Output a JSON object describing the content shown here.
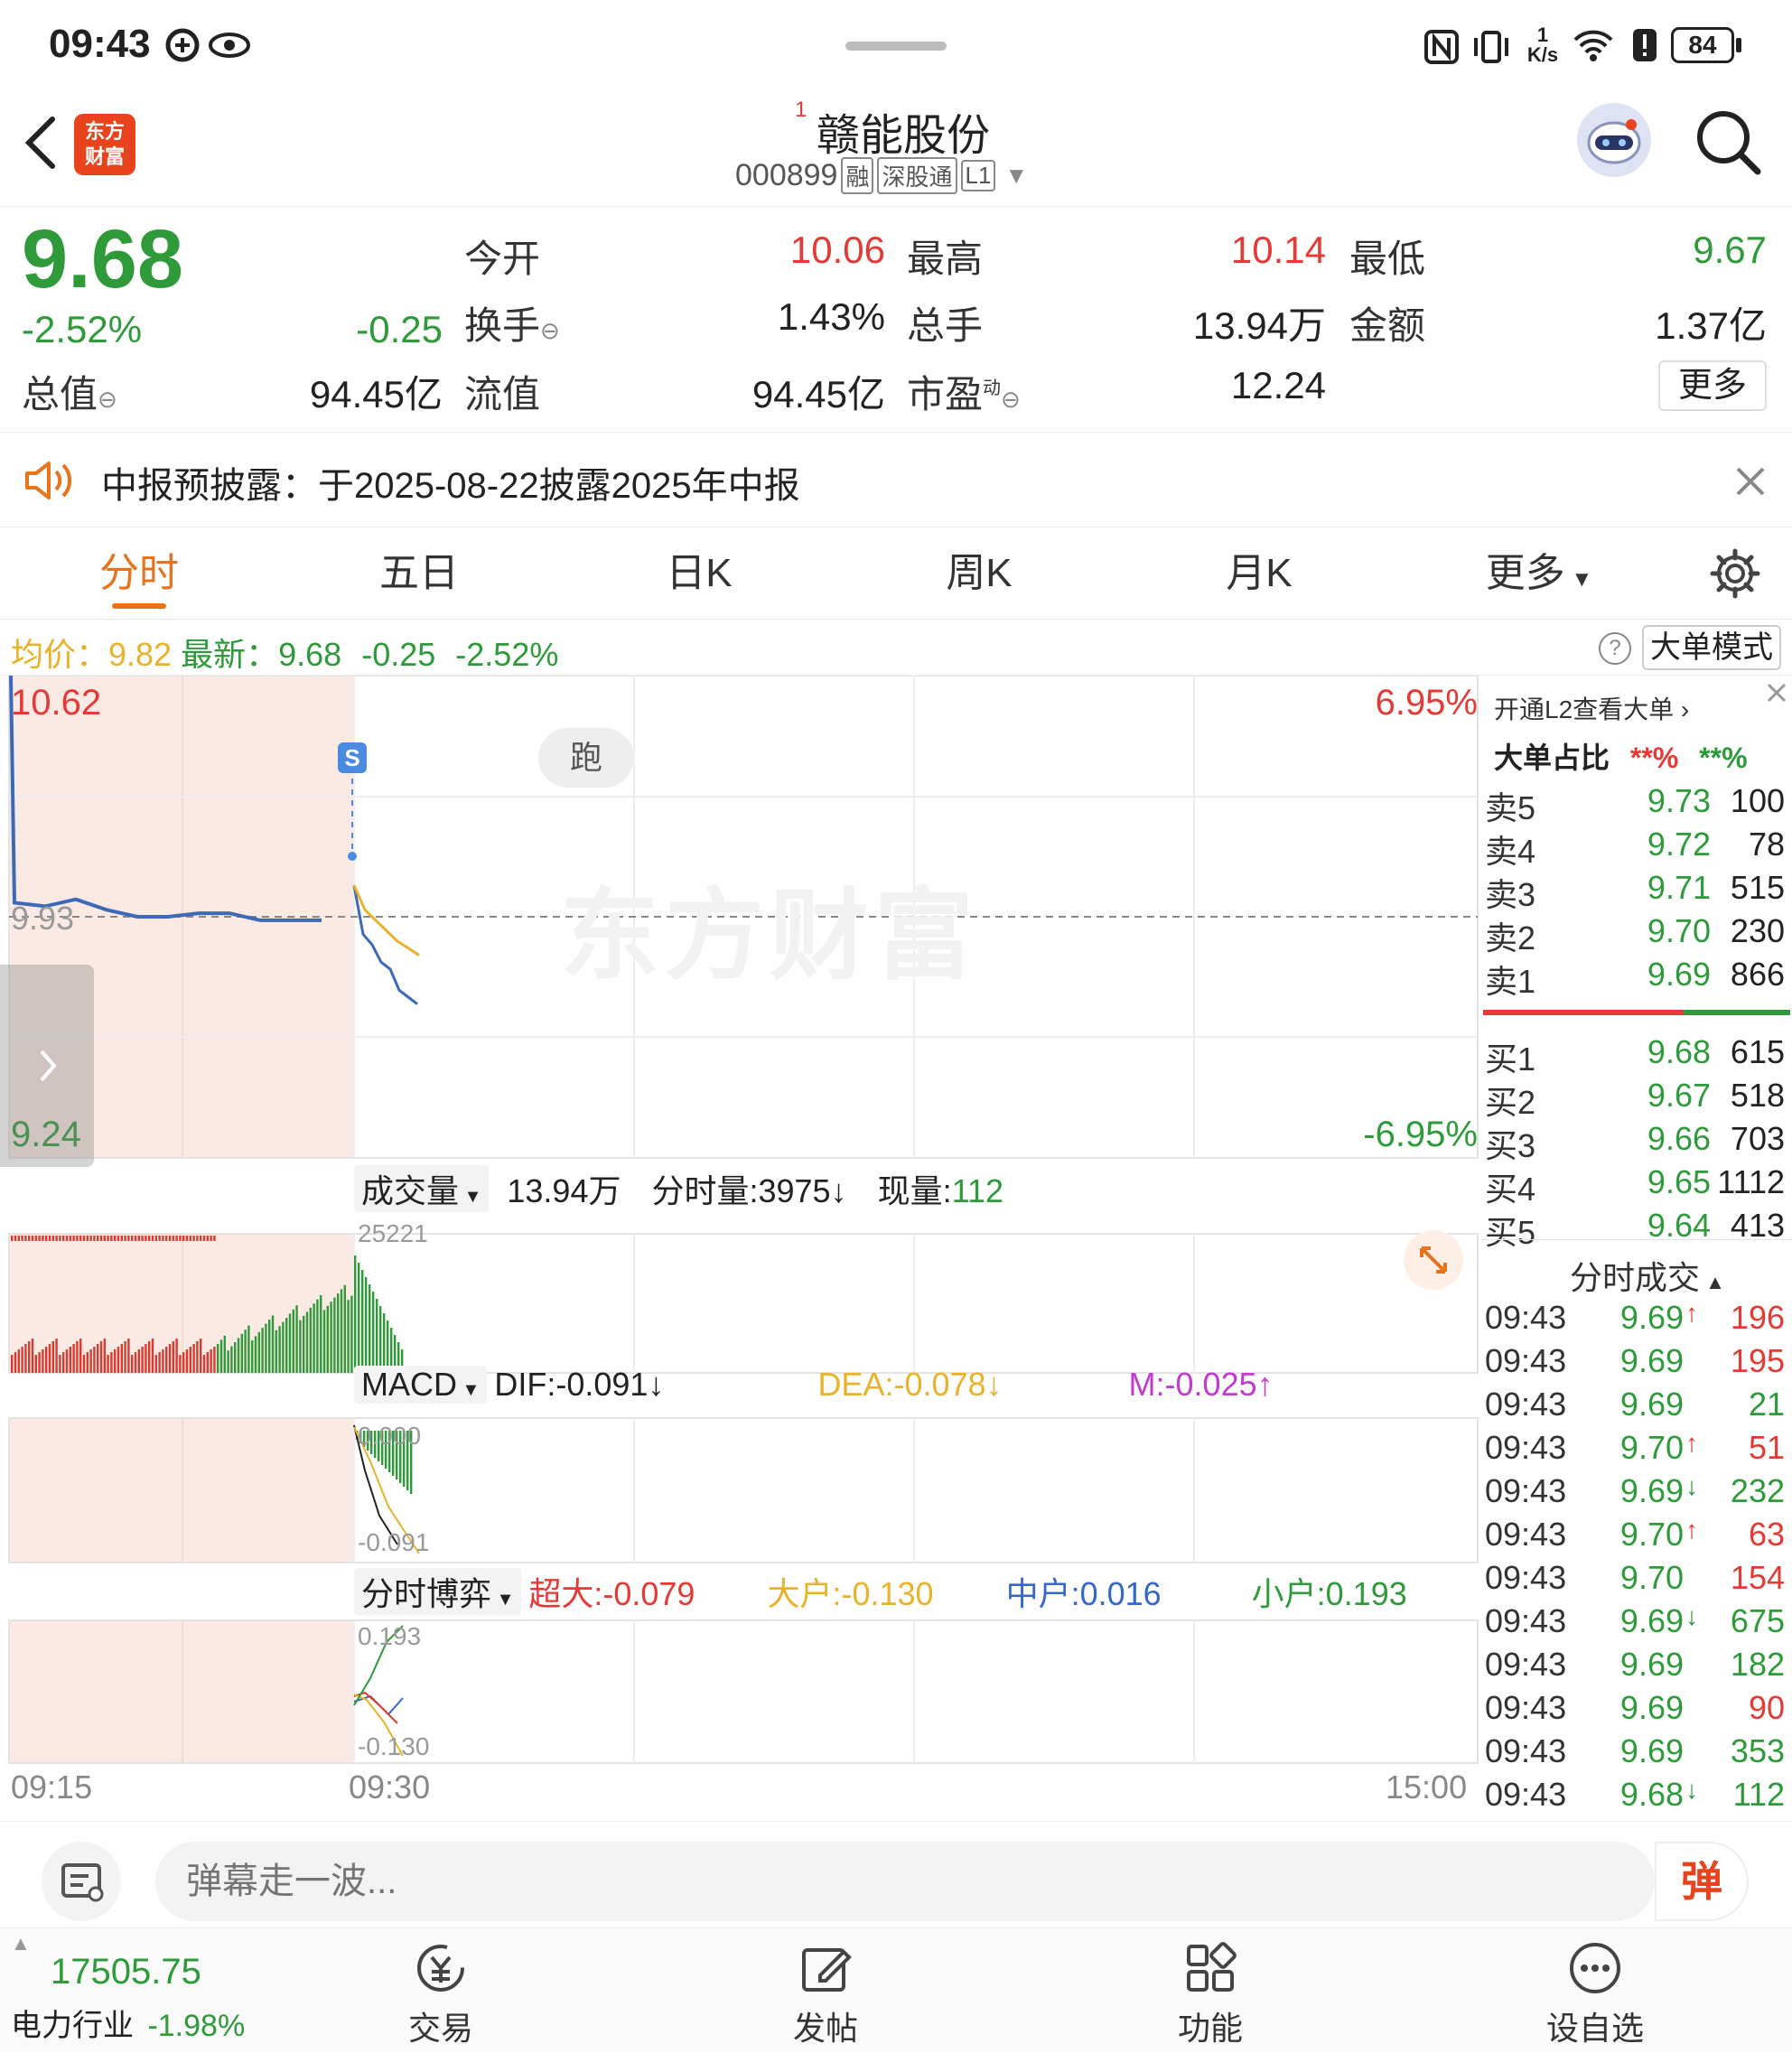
{
  "status": {
    "time": "09:43",
    "battery": "84",
    "net_speed_top": "1",
    "net_speed_unit": "K/s"
  },
  "header": {
    "stock_name": "赣能股份",
    "superscript": "1",
    "code": "000899",
    "tags": [
      "融",
      "深股通",
      "L1"
    ],
    "logo_line1": "东方",
    "logo_line2": "财富"
  },
  "quote": {
    "price": "9.68",
    "change_pct": "-2.52%",
    "change": "-0.25",
    "open_label": "今开",
    "open": "10.06",
    "high_label": "最高",
    "high": "10.14",
    "low_label": "最低",
    "low": "9.67",
    "turnover_label": "换手",
    "turnover": "1.43%",
    "volume_label": "总手",
    "volume": "13.94万",
    "amount_label": "金额",
    "amount": "1.37亿",
    "mktcap_label": "总值",
    "mktcap": "94.45亿",
    "float_label": "流值",
    "float_cap": "94.45亿",
    "pe_label": "市盈",
    "pe_sup": "动",
    "pe": "12.24",
    "more": "更多"
  },
  "notice": {
    "text": "中报预披露：于2025-08-22披露2025年中报"
  },
  "tabs": [
    "分时",
    "五日",
    "日K",
    "周K",
    "月K",
    "更多"
  ],
  "infobar": {
    "avg_label": "均价：",
    "avg": "9.82",
    "latest_label": "最新：",
    "latest": "9.68",
    "change": "-0.25",
    "change_pct": "-2.52%",
    "mode_button": "大单模式"
  },
  "chart": {
    "y_high": "10.62",
    "y_low": "9.24",
    "y_mid": "9.93",
    "pct_high": "6.95%",
    "pct_low": "-6.95%",
    "run_label": "跑",
    "s_marker": "S",
    "watermark": "东方财富",
    "x_labels": [
      "09:15",
      "09:30",
      "15:00"
    ],
    "volume_pane": {
      "label": "成交量",
      "total": "13.94万",
      "minute_label": "分时量:3975",
      "minute_arrow": "↓",
      "cur_label": "现量:",
      "cur": "112",
      "max": "25221"
    },
    "macd_pane": {
      "label": "MACD",
      "dif": "DIF:-0.091",
      "dif_arrow": "↓",
      "dea": "DEA:-0.078",
      "dea_arrow": "↓",
      "m": "M:-0.025",
      "m_arrow": "↑",
      "top": "0.000",
      "bottom": "-0.091"
    },
    "game_pane": {
      "label": "分时博弈",
      "super": "超大:-0.079",
      "big": "大户:-0.130",
      "mid": "中户:0.016",
      "small": "小户:0.193",
      "top": "0.193",
      "bottom": "-0.130"
    }
  },
  "chart_data": {
    "type": "line",
    "title": "",
    "ylim": [
      9.24,
      10.62
    ],
    "series": [
      {
        "name": "price",
        "values": [
          10.62,
          9.97,
          9.96,
          9.98,
          9.95,
          9.93,
          9.93,
          9.94,
          9.94,
          9.92,
          9.92,
          9.92,
          10.02,
          9.88,
          9.85,
          9.8,
          9.78,
          9.72,
          9.7,
          9.68
        ]
      },
      {
        "name": "avg",
        "values": [
          10.02,
          9.95,
          9.92,
          9.89,
          9.86,
          9.84,
          9.82
        ]
      }
    ],
    "xlabel": "",
    "ylabel": ""
  },
  "book": {
    "l2_link": "开通L2查看大单",
    "big_ratio_label": "大单占比",
    "big_ratio_a": "**%",
    "big_ratio_b": "**%",
    "asks": [
      [
        "卖5",
        "9.73",
        "100"
      ],
      [
        "卖4",
        "9.72",
        "78"
      ],
      [
        "卖3",
        "9.71",
        "515"
      ],
      [
        "卖2",
        "9.70",
        "230"
      ],
      [
        "卖1",
        "9.69",
        "866"
      ]
    ],
    "bids": [
      [
        "买1",
        "9.68",
        "615"
      ],
      [
        "买2",
        "9.67",
        "518"
      ],
      [
        "买3",
        "9.66",
        "703"
      ],
      [
        "买4",
        "9.65",
        "1112"
      ],
      [
        "买5",
        "9.64",
        "413"
      ]
    ],
    "trades_label": "分时成交",
    "trades": [
      [
        "09:43",
        "9.69",
        "↑",
        "196",
        "red"
      ],
      [
        "09:43",
        "9.69",
        "",
        "195",
        "red"
      ],
      [
        "09:43",
        "9.69",
        "",
        "21",
        "green"
      ],
      [
        "09:43",
        "9.70",
        "↑",
        "51",
        "red"
      ],
      [
        "09:43",
        "9.69",
        "↓",
        "232",
        "green"
      ],
      [
        "09:43",
        "9.70",
        "↑",
        "63",
        "red"
      ],
      [
        "09:43",
        "9.70",
        "",
        "154",
        "red"
      ],
      [
        "09:43",
        "9.69",
        "↓",
        "675",
        "green"
      ],
      [
        "09:43",
        "9.69",
        "",
        "182",
        "green"
      ],
      [
        "09:43",
        "9.69",
        "",
        "90",
        "red"
      ],
      [
        "09:43",
        "9.69",
        "",
        "353",
        "green"
      ],
      [
        "09:43",
        "9.68",
        "↓",
        "112",
        "green"
      ]
    ]
  },
  "input": {
    "placeholder": "弹幕走一波...",
    "danmu_button": "弹"
  },
  "nav": {
    "index_value": "17505.75",
    "index_name": "电力行业",
    "index_change": "-1.98%",
    "items": [
      "交易",
      "发帖",
      "功能",
      "设自选"
    ]
  }
}
